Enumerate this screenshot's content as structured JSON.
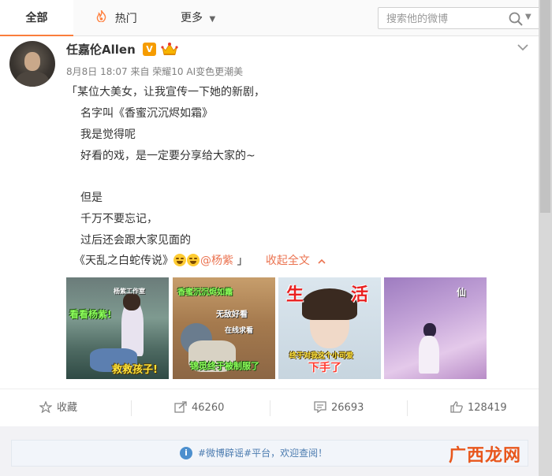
{
  "nav": {
    "tabs": [
      {
        "label": "全部",
        "active": true
      },
      {
        "label": "热门",
        "icon": "fire-icon"
      },
      {
        "label": "更多",
        "icon": "chevron-down-icon"
      }
    ],
    "search_placeholder": "搜索他的微博"
  },
  "post": {
    "author": "任嘉伦Allen",
    "verified_badge": "V",
    "meta": "8月8日 18:07 来自 荣耀10 AI变色更潮美",
    "lines": [
      "「某位大美女，让我宣传一下她的新剧，",
      "名字叫《香蜜沉沉烬如霜》",
      "我是觉得呢",
      "好看的戏，是一定要分享给大家的~",
      "但是",
      "千万不要忘记，",
      "过后还会跟大家见面的",
      "《天乱之白蛇传说》"
    ],
    "mention": "@杨紫",
    "quote_close": "」",
    "collapse_label": "收起全文",
    "photos": [
      {
        "captions": [
          "杨紫工作室",
          "看看杨紫!",
          "救救孩子!"
        ]
      },
      {
        "captions": [
          "香蜜沉沉烬如霜",
          "无敌好看",
          "在线求看",
          "锦觅终于被制服了"
        ]
      },
      {
        "captions": [
          "生",
          "活",
          "终于对我这个小可爱",
          "下手了"
        ]
      },
      {
        "captions": [
          "仙"
        ]
      }
    ]
  },
  "actions": {
    "favorite_label": "收藏",
    "forward_count": "46260",
    "comment_count": "26693",
    "like_count": "128419"
  },
  "notice": {
    "text": "#微博辟谣#平台，欢迎查阅！"
  },
  "watermark": "广西龙网",
  "colors": {
    "accent": "#fa7d3c",
    "link": "#eb7350",
    "notice_text": "#4c7cb0"
  }
}
